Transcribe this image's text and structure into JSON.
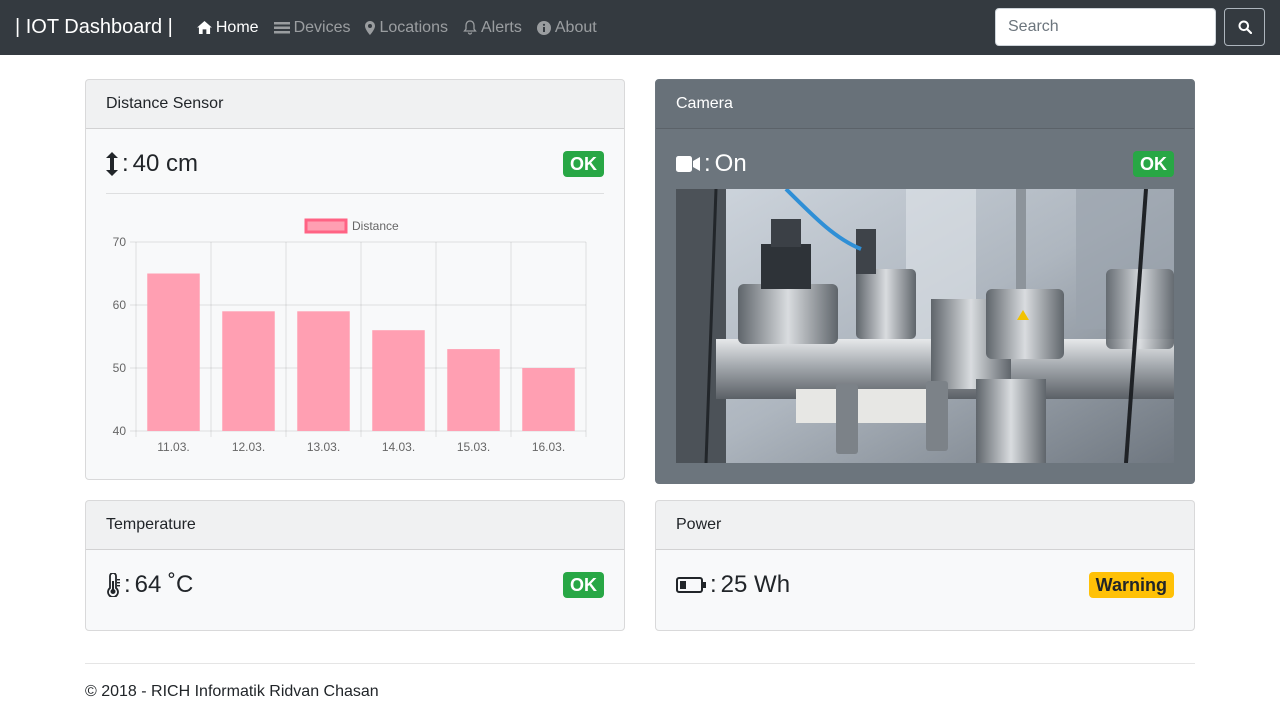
{
  "navbar": {
    "brand": "| IOT Dashboard |",
    "items": [
      {
        "label": "Home",
        "icon": "home-icon",
        "active": true
      },
      {
        "label": "Devices",
        "icon": "list-icon",
        "active": false
      },
      {
        "label": "Locations",
        "icon": "map-marker-icon",
        "active": false
      },
      {
        "label": "Alerts",
        "icon": "bell-icon",
        "active": false
      },
      {
        "label": "About",
        "icon": "info-circle-icon",
        "active": false
      }
    ],
    "search_placeholder": "Search"
  },
  "cards": {
    "distance": {
      "title": "Distance Sensor",
      "value": "40 cm",
      "status": "OK"
    },
    "camera": {
      "title": "Camera",
      "value": "On",
      "status": "OK"
    },
    "temperature": {
      "title": "Temperature",
      "value": "64 ˚C",
      "status": "OK"
    },
    "power": {
      "title": "Power",
      "value": "25 Wh",
      "status": "Warning"
    }
  },
  "chart_data": {
    "type": "bar",
    "categories": [
      "11.03.",
      "12.03.",
      "13.03.",
      "14.03.",
      "15.03.",
      "16.03."
    ],
    "series": [
      {
        "name": "Distance",
        "values": [
          65,
          59,
          59,
          56,
          53,
          50
        ]
      }
    ],
    "ylim": [
      40,
      70
    ],
    "yticks": [
      40,
      50,
      60,
      70
    ],
    "grid": true,
    "legend": "top",
    "colors": {
      "fill": "#ff9fb2",
      "border": "#ff6384"
    }
  },
  "colors": {
    "navbar": "#343a40",
    "ok": "#28a745",
    "warning": "#ffc107",
    "camera_card": "#6c757d"
  },
  "footer": "© 2018 - RICH Informatik Ridvan Chasan"
}
